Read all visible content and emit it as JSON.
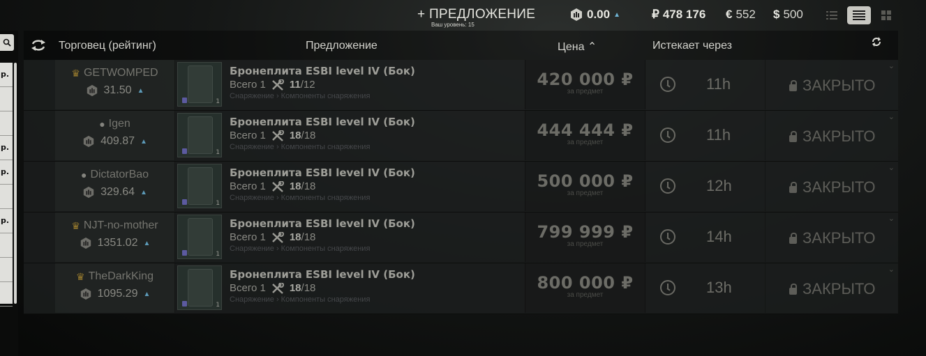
{
  "topbar": {
    "add_offer": "+ ПРЕДЛОЖЕНИЕ",
    "level": "Ваш уровень: 15",
    "rating": "0.00",
    "rub_sym": "₽",
    "rub": "478 176",
    "eur_sym": "€",
    "eur": "552",
    "usd_sym": "$",
    "usd": "500"
  },
  "headers": {
    "trader": "Торговец (рейтинг)",
    "offer": "Предложение",
    "price": "Цена ⌃",
    "expires": "Истекает через"
  },
  "left_list": [
    "р.",
    "",
    "",
    "р.",
    "р.",
    "",
    "р.",
    "",
    "",
    ""
  ],
  "offers": [
    {
      "seller": "GETWOMPED",
      "icon": "crown",
      "rating": "31.50",
      "title": "Бронеплита ESBI level IV (Бок)",
      "total": "Всего 1",
      "durability_cur": "11",
      "durability_max": "/12",
      "category": "Снаряжение › Компоненты снаряжения",
      "count": "1",
      "price": "420 000",
      "currency": "₽",
      "per_item": "за предмет",
      "expires": "11h",
      "action": "ЗАКРЫТО"
    },
    {
      "seller": "Igen",
      "icon": "person",
      "rating": "409.87",
      "title": "Бронеплита ESBI level IV (Бок)",
      "total": "Всего 1",
      "durability_cur": "18",
      "durability_max": "/18",
      "category": "Снаряжение › Компоненты снаряжения",
      "count": "1",
      "price": "444 444",
      "currency": "₽",
      "per_item": "за предмет",
      "expires": "11h",
      "action": "ЗАКРЫТО"
    },
    {
      "seller": "DictatorBao",
      "icon": "person",
      "rating": "329.64",
      "title": "Бронеплита ESBI level IV (Бок)",
      "total": "Всего 1",
      "durability_cur": "18",
      "durability_max": "/18",
      "category": "Снаряжение › Компоненты снаряжения",
      "count": "1",
      "price": "500 000",
      "currency": "₽",
      "per_item": "за предмет",
      "expires": "12h",
      "action": "ЗАКРЫТО"
    },
    {
      "seller": "NJT-no-mother",
      "icon": "crown",
      "rating": "1351.02",
      "title": "Бронеплита ESBI level IV (Бок)",
      "total": "Всего 1",
      "durability_cur": "18",
      "durability_max": "/18",
      "category": "Снаряжение › Компоненты снаряжения",
      "count": "1",
      "price": "799 999",
      "currency": "₽",
      "per_item": "за предмет",
      "expires": "14h",
      "action": "ЗАКРЫТО"
    },
    {
      "seller": "TheDarkKing",
      "icon": "crown",
      "rating": "1095.29",
      "title": "Бронеплита ESBI level IV (Бок)",
      "total": "Всего 1",
      "durability_cur": "18",
      "durability_max": "/18",
      "category": "Снаряжение › Компоненты снаряжения",
      "count": "1",
      "price": "800 000",
      "currency": "₽",
      "per_item": "за предмет",
      "expires": "13h",
      "action": "ЗАКРЫТО"
    }
  ]
}
